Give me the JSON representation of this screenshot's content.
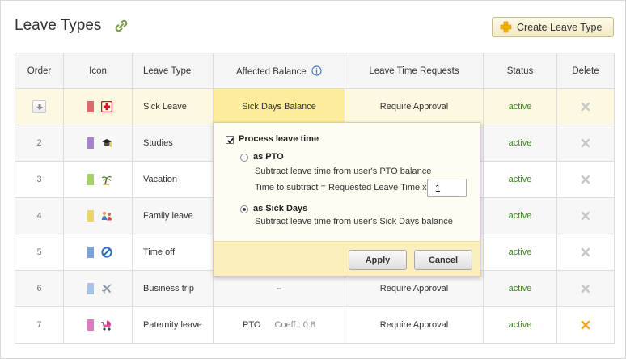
{
  "header": {
    "title": "Leave Types",
    "create_label": "Create Leave Type"
  },
  "columns": {
    "order": "Order",
    "icon": "Icon",
    "leave_type": "Leave Type",
    "affected_balance": "Affected Balance",
    "requests": "Leave Time Requests",
    "status": "Status",
    "delete": "Delete"
  },
  "rows": [
    {
      "order": "",
      "color": "#e0686b",
      "icon": "first-aid-icon",
      "name": "Sick Leave",
      "balance": "Sick Days Balance",
      "coeff": "",
      "requests": "Require Approval",
      "status": "active",
      "delete_color": "#c8c8c8"
    },
    {
      "order": "2",
      "color": "#a583d1",
      "icon": "graduation-cap-icon",
      "name": "Studies",
      "balance": "",
      "coeff": "",
      "requests": "",
      "status": "active",
      "delete_color": "#c8c8c8"
    },
    {
      "order": "3",
      "color": "#a4d266",
      "icon": "palm-tree-icon",
      "name": "Vacation",
      "balance": "",
      "coeff": "",
      "requests": "",
      "status": "active",
      "delete_color": "#c8c8c8"
    },
    {
      "order": "4",
      "color": "#ebd46a",
      "icon": "family-icon",
      "name": "Family leave",
      "balance": "",
      "coeff": "",
      "requests": "",
      "status": "active",
      "delete_color": "#c8c8c8"
    },
    {
      "order": "5",
      "color": "#7aa3dc",
      "icon": "prohibited-icon",
      "name": "Time off",
      "balance": "",
      "coeff": "",
      "requests": "",
      "status": "active",
      "delete_color": "#c8c8c8"
    },
    {
      "order": "6",
      "color": "#a9c3e8",
      "icon": "airplane-icon",
      "name": "Business trip",
      "balance": "–",
      "coeff": "",
      "requests": "Require Approval",
      "status": "active",
      "delete_color": "#c8c8c8"
    },
    {
      "order": "7",
      "color": "#e07ac3",
      "icon": "stroller-icon",
      "name": "Paternity leave",
      "balance": "PTO",
      "coeff": "Coeff.: 0.8",
      "requests": "Require Approval",
      "status": "active",
      "delete_color": "#f5a524"
    }
  ],
  "popup": {
    "title": "Process leave time",
    "pto_label": "as PTO",
    "pto_desc": "Subtract leave time from user's PTO balance",
    "time_formula": "Time to subtract = Requested Leave Time x",
    "coef_value": "1",
    "sick_label": "as Sick Days",
    "sick_desc": "Subtract leave time from user's Sick Days balance",
    "apply_label": "Apply",
    "cancel_label": "Cancel"
  },
  "colors": {
    "accent_yellow": "#fcec9c",
    "status_green": "#3a8a1f"
  }
}
